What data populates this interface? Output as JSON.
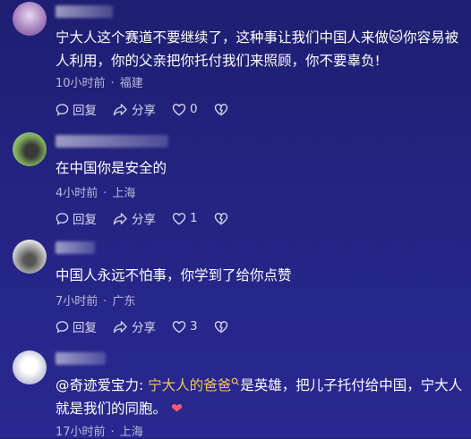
{
  "comments": [
    {
      "text": "宁大人这个赛道不要继续了，这种事让我们中国人来做🐱你容易被人利用，你的父亲把你托付我们来照顾，你不要辜负!",
      "time": "10小时前",
      "location": "福建",
      "reply_label": "回复",
      "share_label": "分享",
      "like_count": "0"
    },
    {
      "text": "在中国你是安全的",
      "time": "4小时前",
      "location": "上海",
      "reply_label": "回复",
      "share_label": "分享",
      "like_count": "1"
    },
    {
      "text": "中国人永远不怕事，你学到了给你点赞",
      "time": "7小时前",
      "location": "广东",
      "reply_label": "回复",
      "share_label": "分享",
      "like_count": "3"
    },
    {
      "mention": "@奇迹爱宝力:",
      "highlight": "宁大人的爸爸",
      "text_rest": "是英雄，把儿子托付给中国，宁大人就是我们的同胞。",
      "heart": "❤",
      "time": "17小时前",
      "location": "上海"
    }
  ],
  "separator": "·",
  "colors": {
    "background": "#23227e",
    "highlight": "#f2c65a",
    "meta": "#b8b8d8"
  }
}
